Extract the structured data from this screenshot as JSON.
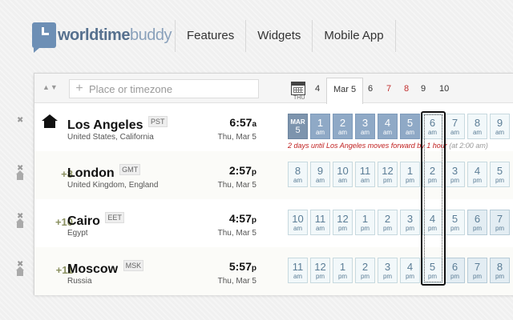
{
  "header": {
    "logo_bold": "worldtime",
    "logo_light": "buddy",
    "nav": [
      "Features",
      "Widgets",
      "Mobile App"
    ]
  },
  "toolbar": {
    "sort_arrows": "▲▼",
    "search_placeholder": "Place or timezone",
    "date_tabs": [
      {
        "label": "4",
        "weekend": false,
        "active": false
      },
      {
        "label": "Mar 5",
        "weekend": false,
        "active": true
      },
      {
        "label": "6",
        "weekend": false,
        "active": false
      },
      {
        "label": "7",
        "weekend": true,
        "active": false
      },
      {
        "label": "8",
        "weekend": true,
        "active": false
      },
      {
        "label": "9",
        "weekend": false,
        "active": false
      },
      {
        "label": "10",
        "weekend": false,
        "active": false
      }
    ]
  },
  "rows": [
    {
      "home": true,
      "offset": "",
      "city": "Los Angeles",
      "abbr": "PST",
      "region": "United States, California",
      "time": "6:57",
      "meridiem": "a",
      "date": "Thu, Mar 5",
      "weekday_label": "THU",
      "cells": [
        {
          "hr": "MAR",
          "ap": "5",
          "kind": "date"
        },
        {
          "hr": "1",
          "ap": "am",
          "kind": "past"
        },
        {
          "hr": "2",
          "ap": "am",
          "kind": "past"
        },
        {
          "hr": "3",
          "ap": "am",
          "kind": "past"
        },
        {
          "hr": "4",
          "ap": "am",
          "kind": "past"
        },
        {
          "hr": "5",
          "ap": "am",
          "kind": "past"
        },
        {
          "hr": "6",
          "ap": "am",
          "kind": "day"
        },
        {
          "hr": "7",
          "ap": "am",
          "kind": "day"
        },
        {
          "hr": "8",
          "ap": "am",
          "kind": "day"
        },
        {
          "hr": "9",
          "ap": "am",
          "kind": "day"
        }
      ],
      "note": "2 days until Los Angeles moves forward by 1 hour",
      "note_extra": "(at 2:00 am)"
    },
    {
      "home": false,
      "offset": "+8",
      "city": "London",
      "abbr": "GMT",
      "region": "United Kingdom, England",
      "time": "2:57",
      "meridiem": "p",
      "date": "Thu, Mar 5",
      "cells": [
        {
          "hr": "8",
          "ap": "am",
          "kind": "day"
        },
        {
          "hr": "9",
          "ap": "am",
          "kind": "day"
        },
        {
          "hr": "10",
          "ap": "am",
          "kind": "day"
        },
        {
          "hr": "11",
          "ap": "am",
          "kind": "day"
        },
        {
          "hr": "12",
          "ap": "pm",
          "kind": "day"
        },
        {
          "hr": "1",
          "ap": "pm",
          "kind": "day"
        },
        {
          "hr": "2",
          "ap": "pm",
          "kind": "day"
        },
        {
          "hr": "3",
          "ap": "pm",
          "kind": "day"
        },
        {
          "hr": "4",
          "ap": "pm",
          "kind": "day"
        },
        {
          "hr": "5",
          "ap": "pm",
          "kind": "day"
        }
      ]
    },
    {
      "home": false,
      "offset": "+10",
      "city": "Cairo",
      "abbr": "EET",
      "region": "Egypt",
      "time": "4:57",
      "meridiem": "p",
      "date": "Thu, Mar 5",
      "cells": [
        {
          "hr": "10",
          "ap": "am",
          "kind": "day"
        },
        {
          "hr": "11",
          "ap": "am",
          "kind": "day"
        },
        {
          "hr": "12",
          "ap": "pm",
          "kind": "day"
        },
        {
          "hr": "1",
          "ap": "pm",
          "kind": "day"
        },
        {
          "hr": "2",
          "ap": "pm",
          "kind": "day"
        },
        {
          "hr": "3",
          "ap": "pm",
          "kind": "day"
        },
        {
          "hr": "4",
          "ap": "pm",
          "kind": "day"
        },
        {
          "hr": "5",
          "ap": "pm",
          "kind": "day"
        },
        {
          "hr": "6",
          "ap": "pm",
          "kind": "night"
        },
        {
          "hr": "7",
          "ap": "pm",
          "kind": "night"
        }
      ]
    },
    {
      "home": false,
      "offset": "+11",
      "city": "Moscow",
      "abbr": "MSK",
      "region": "Russia",
      "time": "5:57",
      "meridiem": "p",
      "date": "Thu, Mar 5",
      "cells": [
        {
          "hr": "11",
          "ap": "am",
          "kind": "day"
        },
        {
          "hr": "12",
          "ap": "pm",
          "kind": "day"
        },
        {
          "hr": "1",
          "ap": "pm",
          "kind": "day"
        },
        {
          "hr": "2",
          "ap": "pm",
          "kind": "day"
        },
        {
          "hr": "3",
          "ap": "pm",
          "kind": "day"
        },
        {
          "hr": "4",
          "ap": "pm",
          "kind": "day"
        },
        {
          "hr": "5",
          "ap": "pm",
          "kind": "day"
        },
        {
          "hr": "6",
          "ap": "pm",
          "kind": "night"
        },
        {
          "hr": "7",
          "ap": "pm",
          "kind": "night"
        },
        {
          "hr": "8",
          "ap": "pm",
          "kind": "night"
        }
      ]
    }
  ],
  "colors": {
    "brand": "#56708e",
    "accent_past": "#8fa9c6",
    "dst_note": "#c02020",
    "offset": "#8a9060"
  }
}
